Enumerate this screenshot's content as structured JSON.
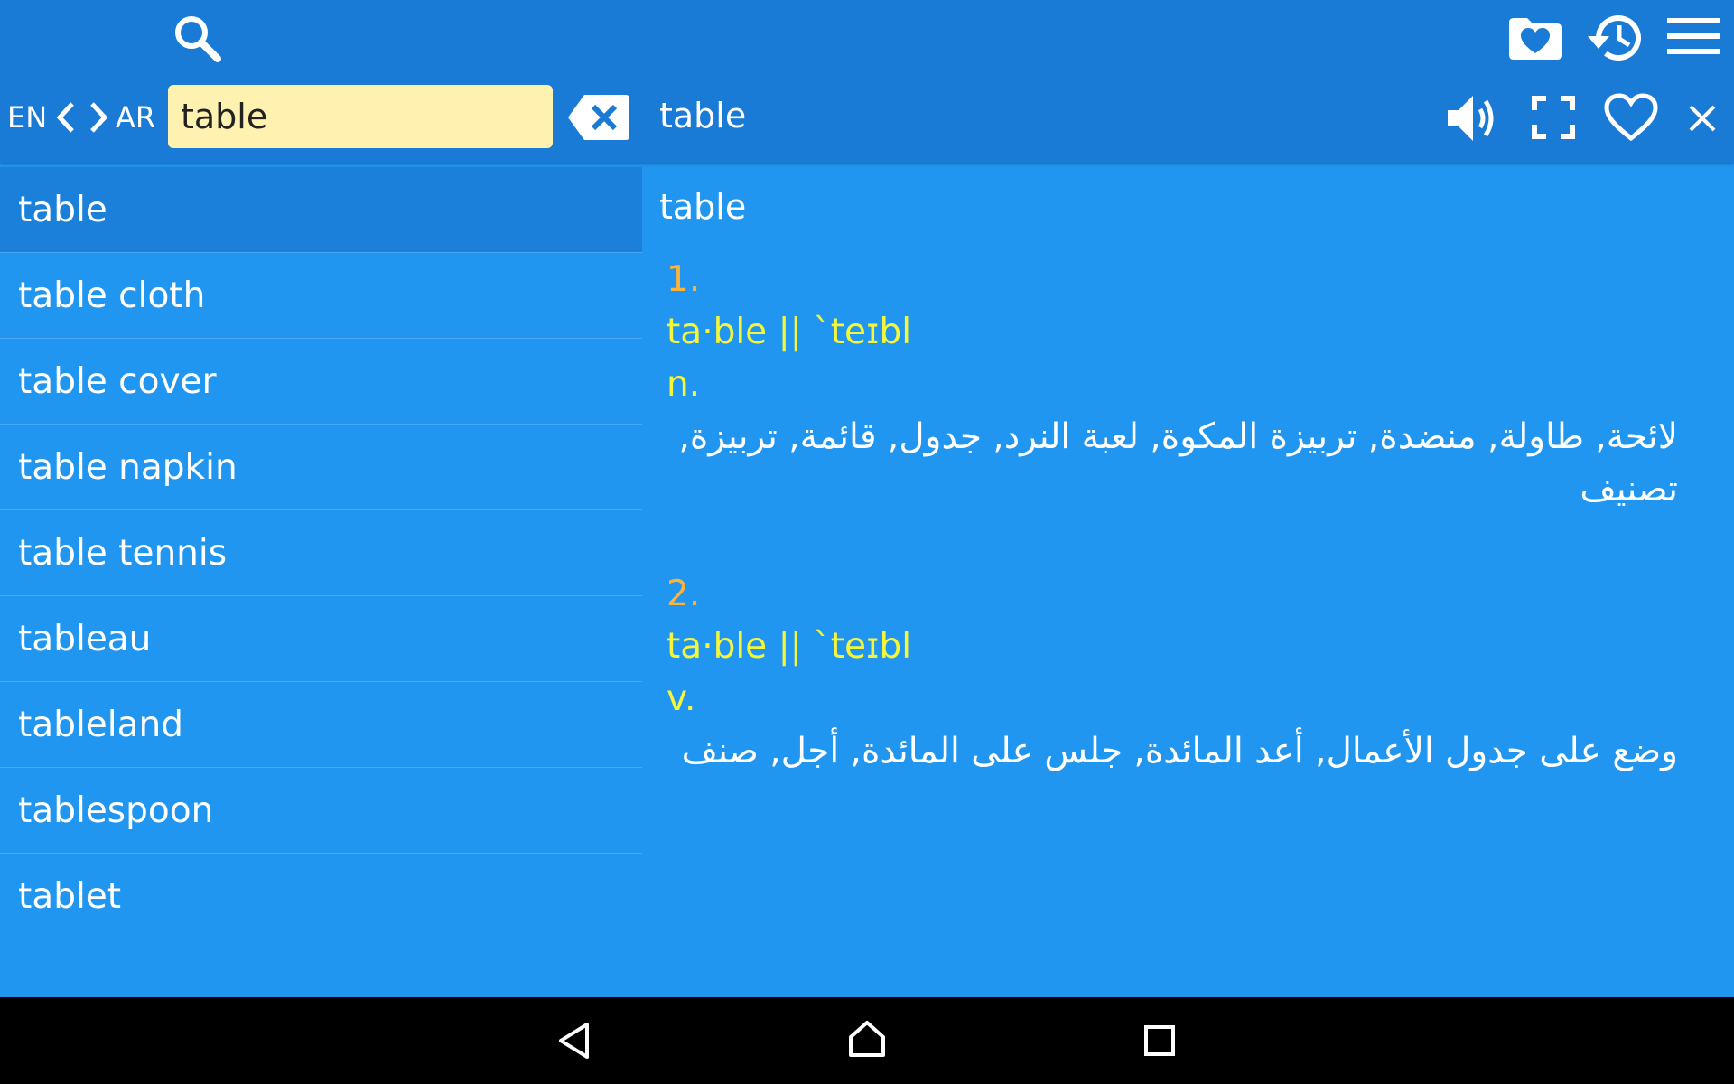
{
  "colors": {
    "topbar": "#1a7bd6",
    "background": "#2196f0",
    "selected_row": "#1b80da",
    "search_field": "#fff2b0",
    "entry_number": "#ffb23a",
    "phonetic": "#f5f53a",
    "navbar": "#000000"
  },
  "toolbar": {
    "icons": [
      "search-icon",
      "favorites-folder-icon",
      "history-icon",
      "menu-icon"
    ]
  },
  "search": {
    "source_lang": "EN",
    "target_lang": "AR",
    "value": "table"
  },
  "detail_toolbar": {
    "headword": "table",
    "icons": [
      "speaker-icon",
      "fullscreen-icon",
      "heart-icon",
      "close-icon"
    ]
  },
  "wordlist": {
    "selected_index": 0,
    "items": [
      "table",
      "table cloth",
      "table cover",
      "table napkin",
      "table tennis",
      "tableau",
      "tableland",
      "tablespoon",
      "tablet"
    ]
  },
  "entry": {
    "headword": "table",
    "senses": [
      {
        "number": "1.",
        "phonetic": "ta·ble || `teɪbl",
        "pos": "n.",
        "translation": "لائحة, طاولة, منضدة, تربيزة المكوة, لعبة النرد, جدول, قائمة, تربيزة, تصنيف"
      },
      {
        "number": "2.",
        "phonetic": "ta·ble || `teɪbl",
        "pos": "v.",
        "translation": "وضع على جدول الأعمال, أعد المائدة, جلس على المائدة, أجل, صنف"
      }
    ]
  },
  "navbar": {
    "icons": [
      "back-icon",
      "home-icon",
      "recents-icon"
    ]
  }
}
